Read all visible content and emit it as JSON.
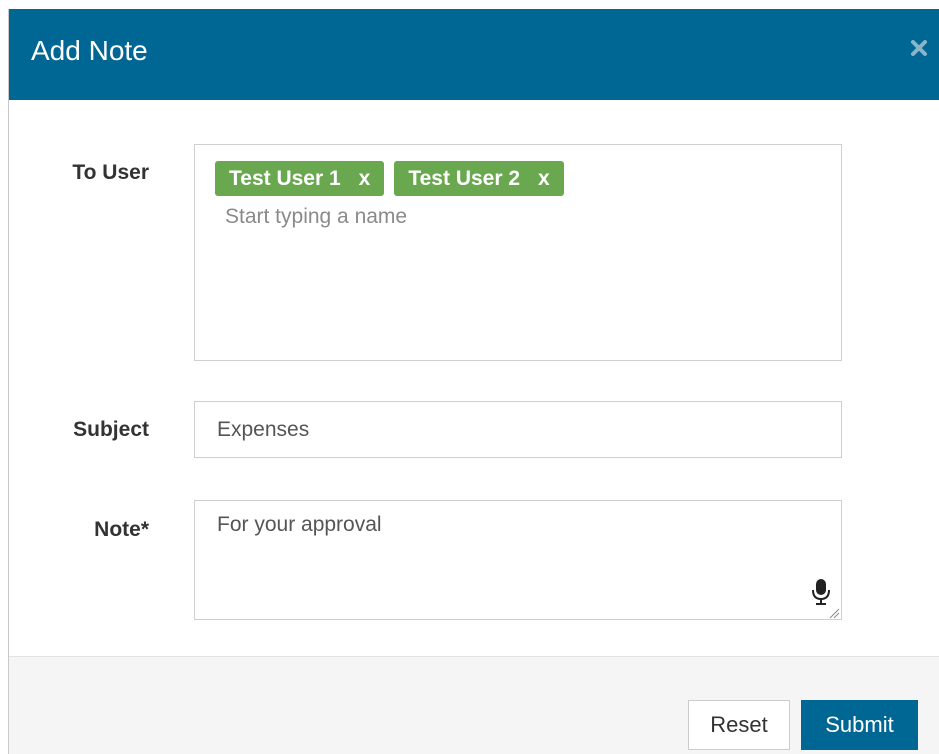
{
  "modal": {
    "title": "Add Note"
  },
  "form": {
    "to_user": {
      "label": "To User",
      "tags": [
        {
          "name": "Test User 1",
          "remove": "x"
        },
        {
          "name": "Test User 2",
          "remove": "x"
        }
      ],
      "placeholder": "Start typing a name"
    },
    "subject": {
      "label": "Subject",
      "value": "Expenses"
    },
    "note": {
      "label": "Note*",
      "value": "For your approval"
    }
  },
  "footer": {
    "reset_label": "Reset",
    "submit_label": "Submit"
  },
  "colors": {
    "header_bg": "#006794",
    "tag_bg": "#6aa84f",
    "submit_bg": "#006794"
  },
  "icons": {
    "close": "close-icon",
    "mic": "microphone-icon",
    "resize": "resize-handle-icon"
  }
}
